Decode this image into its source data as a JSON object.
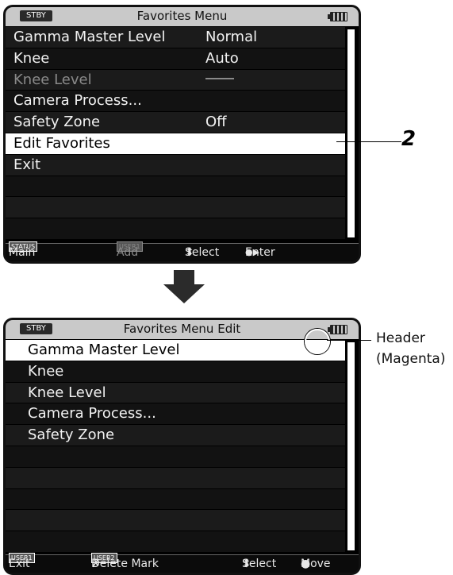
{
  "menu1": {
    "status_tag": "STBY",
    "title": "Favorites Menu",
    "items": [
      {
        "label": "Gamma Master Level",
        "value": "Normal"
      },
      {
        "label": "Knee",
        "value": "Auto"
      },
      {
        "label": "Knee Level",
        "value": ""
      },
      {
        "label": "Camera Process...",
        "value": ""
      },
      {
        "label": "Safety Zone",
        "value": "Off"
      },
      {
        "label": "Edit Favorites",
        "value": ""
      },
      {
        "label": "Exit",
        "value": ""
      }
    ],
    "footer": {
      "status_tag": "STATUS",
      "main": "Main",
      "user_tag": "USER1",
      "add": "Add",
      "select_glyph": "⬍",
      "select": "Select",
      "enter_glyph": "●▶",
      "enter": "Enter"
    }
  },
  "callout_number": "2",
  "menu2": {
    "status_tag": "STBY",
    "title": "Favorites Menu Edit",
    "items": [
      {
        "label": "Gamma Master Level"
      },
      {
        "label": "Knee"
      },
      {
        "label": "Knee Level"
      },
      {
        "label": "Camera Process..."
      },
      {
        "label": "Safety Zone"
      }
    ],
    "footer": {
      "user1_tag": "USER1",
      "exit": "Exit",
      "user2_tag": "USER2",
      "delete_glyph": "✗",
      "delete_mark": "Delete Mark",
      "select_glyph": "⬍",
      "select": "Select",
      "move_glyph": "●",
      "move": "Move"
    }
  },
  "header_label": {
    "line1": "Header",
    "line2": "(Magenta)"
  },
  "colors": {
    "highlight": "#ffffff",
    "titlebar": "#c9c9c9",
    "screen_bg": "#000000"
  }
}
